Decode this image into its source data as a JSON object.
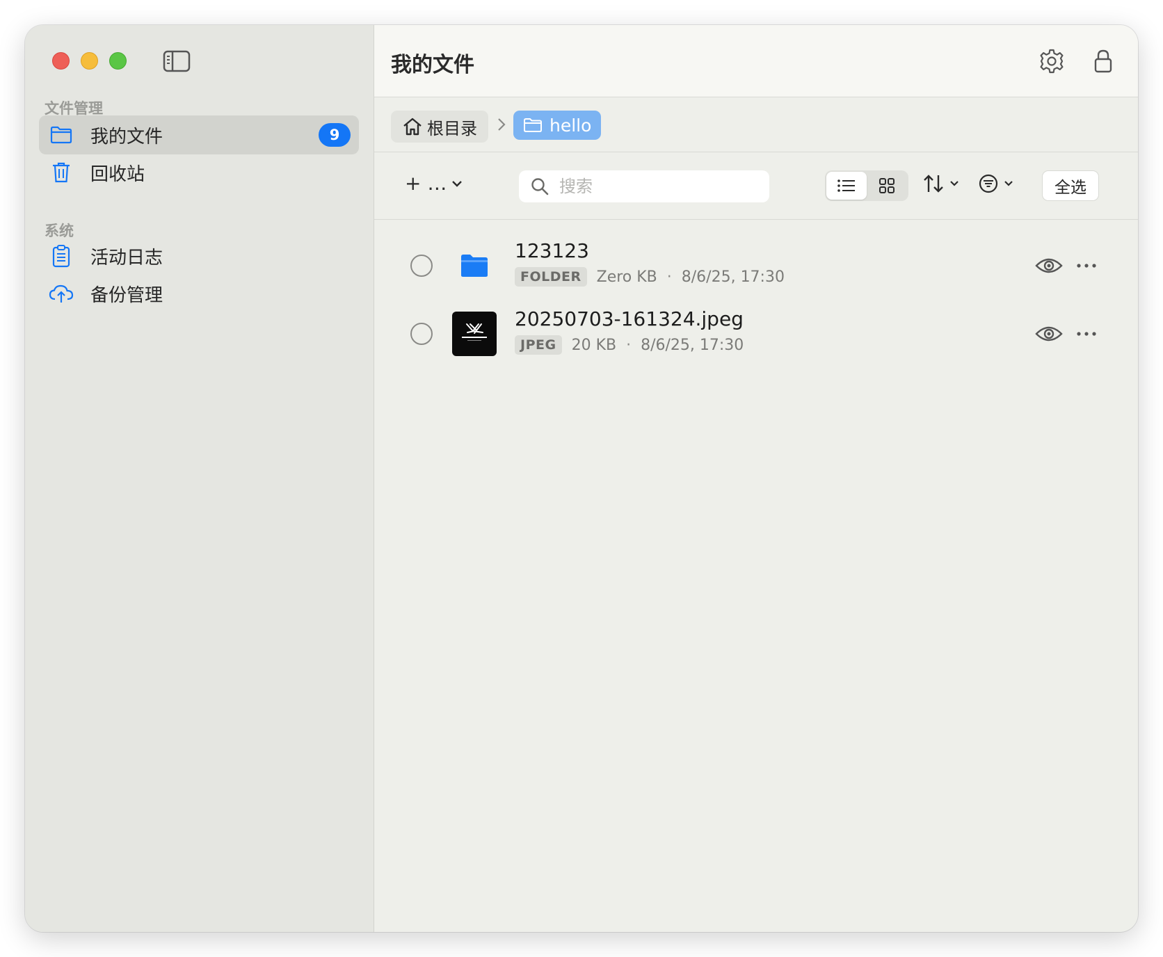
{
  "sidebar": {
    "sections": [
      {
        "title": "文件管理",
        "items": [
          {
            "label": "我的文件",
            "icon": "folder-icon",
            "badge": "9",
            "active": true
          },
          {
            "label": "回收站",
            "icon": "trash-icon"
          }
        ]
      },
      {
        "title": "系统",
        "items": [
          {
            "label": "活动日志",
            "icon": "clipboard-icon"
          },
          {
            "label": "备份管理",
            "icon": "cloud-upload-icon"
          }
        ]
      }
    ]
  },
  "header": {
    "title": "我的文件"
  },
  "breadcrumb": {
    "root": "根目录",
    "current": "hello"
  },
  "toolbar": {
    "add_label": "+ …",
    "search_placeholder": "搜索",
    "select_all": "全选"
  },
  "files": [
    {
      "name": "123123",
      "type": "FOLDER",
      "size": "Zero KB",
      "date": "8/6/25, 17:30",
      "icon": "folder-filled-icon"
    },
    {
      "name": "20250703-161324.jpeg",
      "type": "JPEG",
      "size": "20 KB",
      "date": "8/6/25, 17:30",
      "icon": "image-thumbnail"
    }
  ],
  "meta_separator": "·",
  "colors": {
    "accent": "#1476f6",
    "breadcrumb_current": "#7bb3f2",
    "sidebar_bg": "#e5e6e1"
  }
}
